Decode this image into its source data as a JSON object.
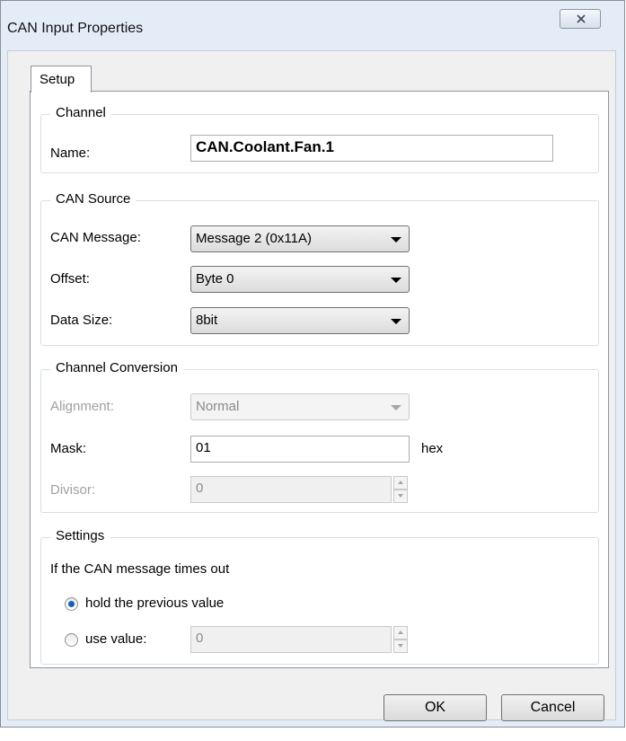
{
  "window": {
    "title": "CAN Input Properties"
  },
  "tabs": [
    {
      "label": "Setup"
    }
  ],
  "channel": {
    "legend": "Channel",
    "name_label": "Name:",
    "name_value": "CAN.Coolant.Fan.1"
  },
  "can_source": {
    "legend": "CAN Source",
    "message_label": "CAN Message:",
    "message_value": "Message 2 (0x11A)",
    "offset_label": "Offset:",
    "offset_value": "Byte 0",
    "datasize_label": "Data Size:",
    "datasize_value": "8bit"
  },
  "conversion": {
    "legend": "Channel Conversion",
    "alignment_label": "Alignment:",
    "alignment_value": "Normal",
    "mask_label": "Mask:",
    "mask_value": "01",
    "mask_unit": "hex",
    "divisor_label": "Divisor:",
    "divisor_value": "0"
  },
  "settings": {
    "legend": "Settings",
    "timeout_text": "If the CAN message times out",
    "hold_label": "hold the previous value",
    "hold_checked": true,
    "use_value_label": "use value:",
    "use_value": "0"
  },
  "buttons": {
    "ok": "OK",
    "cancel": "Cancel"
  },
  "colors": {
    "window_frame": "#e4edf7",
    "radio_dot": "#1b5fb7",
    "group_border": "#d5dfe5"
  }
}
